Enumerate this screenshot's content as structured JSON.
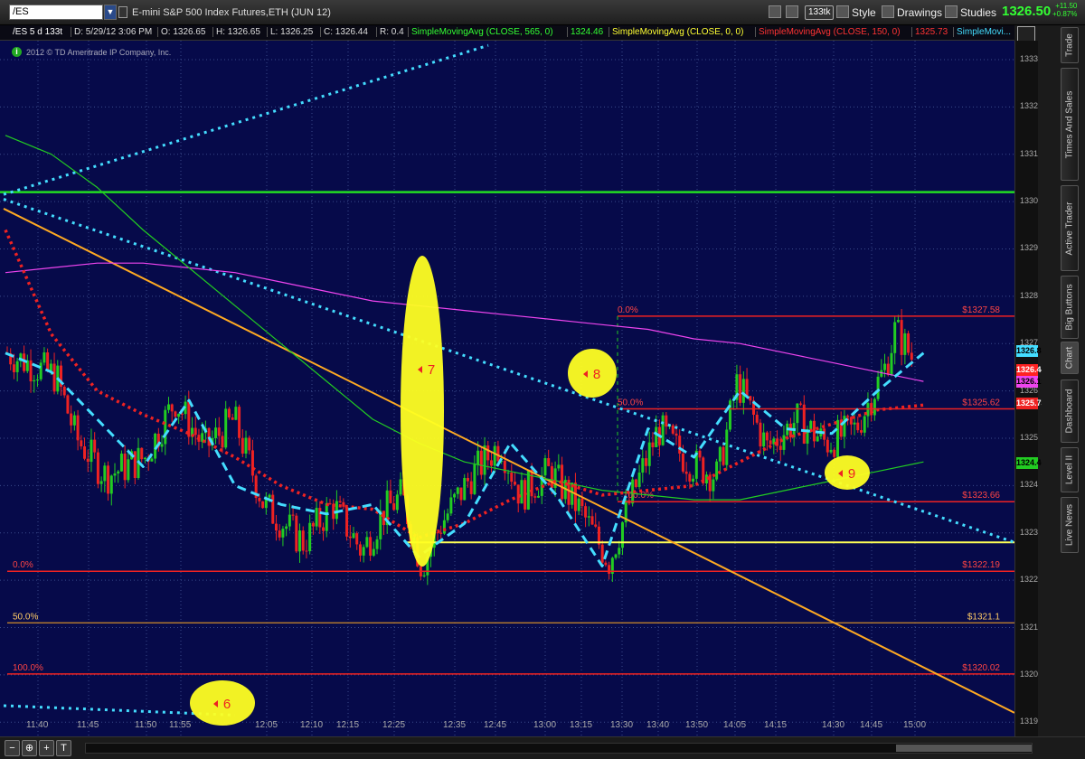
{
  "toolbar": {
    "symbol": "/ES",
    "instrument_title": "E-mini S&P 500 Index Futures,ETH (JUN 12)",
    "aggregation_badge": "133tk",
    "style_label": "Style",
    "drawings_label": "Drawings",
    "studies_label": "Studies",
    "last_price": "1326.50",
    "net_change": "+11.50",
    "pct_change": "+0.87%"
  },
  "infobar": {
    "period": "/ES 5 d 133t",
    "date": "D: 5/29/12 3:06 PM",
    "open": "O: 1326.65",
    "high": "H: 1326.65",
    "low": "L: 1326.25",
    "close": "C: 1326.44",
    "range": "R: 0.4",
    "study1": "SimpleMovingAvg (CLOSE, 565, 0)",
    "study1_value": "1324.46",
    "study2": "SimpleMovingAvg (CLOSE, 0, 0)",
    "study3": "SimpleMovingAvg (CLOSE, 150, 0)",
    "study3_value": "1325.73",
    "study4": "SimpleMovi..."
  },
  "copyright": "2012 © TD Ameritrade IP Company, Inc.",
  "price_axis": {
    "ticks": [
      "1333",
      "1332",
      "1331",
      "1330",
      "1329",
      "1328",
      "1327",
      "1326",
      "1325",
      "1324",
      "1323",
      "1322",
      "1321",
      "1320",
      "1319"
    ],
    "labels": [
      {
        "text": "1326.83",
        "price": 1326.83,
        "bg": "#44ddff",
        "fg": "#000"
      },
      {
        "text": "1326.44",
        "price": 1326.44,
        "bg": "#ff2222",
        "fg": "#fff"
      },
      {
        "text": "1326.19",
        "price": 1326.19,
        "bg": "#ee44ee",
        "fg": "#000"
      },
      {
        "text": "1325.73",
        "price": 1325.73,
        "bg": "#ee2222",
        "fg": "#fff"
      },
      {
        "text": "1324.46",
        "price": 1324.46,
        "bg": "#22cc22",
        "fg": "#000"
      }
    ]
  },
  "time_axis": {
    "ticks": [
      "11:40",
      "11:45",
      "11:50",
      "11:55",
      "12:05",
      "12:10",
      "12:15",
      "12:25",
      "12:35",
      "12:45",
      "13:00",
      "13:15",
      "13:30",
      "13:40",
      "13:50",
      "14:05",
      "14:15",
      "14:30",
      "14:45",
      "15:00"
    ]
  },
  "side_tabs": [
    "Trade",
    "Times And Sales",
    "Active Trader",
    "Big Buttons",
    "Chart",
    "Dashboard",
    "Level II",
    "Live News"
  ],
  "bottom_buttons": [
    "−",
    "⊕",
    "+",
    "T"
  ],
  "chart_data": {
    "type": "line",
    "y_range": [
      1318.7,
      1333.4
    ],
    "annotations": {
      "fib1": [
        {
          "text": "0.0%",
          "price": 1327.58,
          "value_label": "$1327.58"
        },
        {
          "text": "50.0%",
          "price": 1325.62,
          "value_label": "$1325.62"
        },
        {
          "text": "100.0%",
          "price": 1323.66,
          "value_label": "$1323.66"
        }
      ],
      "fib2": [
        {
          "text": "0.0%",
          "price": 1322.19,
          "value_label": "$1322.19"
        },
        {
          "text": "50.0%",
          "price": 1321.1,
          "value_label": "$1321.1"
        },
        {
          "text": "100.0%",
          "price": 1320.02,
          "value_label": "$1320.02"
        }
      ],
      "markers": [
        "6",
        "7",
        "8",
        "9"
      ],
      "green_level": 1330.2,
      "yellow_level": 1322.8
    },
    "colors": {
      "background": "#060a4a",
      "up": "#22cc22",
      "down": "#ee2222",
      "sma_cyan": "#44ddff",
      "sma_red": "#ee2222",
      "sma_magenta": "#ee44ee",
      "sma_green": "#22cc22",
      "trend": "#ffaa22",
      "highlight": "#ffff22"
    },
    "x_pct": [
      0,
      5,
      10,
      15,
      20,
      25,
      30,
      35,
      40,
      45,
      50,
      55,
      60,
      65,
      70,
      75,
      80,
      85,
      90,
      95,
      100
    ],
    "sma_magenta": [
      1328.5,
      1328.6,
      1328.7,
      1328.7,
      1328.6,
      1328.5,
      1328.3,
      1328.1,
      1327.9,
      1327.8,
      1327.7,
      1327.6,
      1327.5,
      1327.4,
      1327.3,
      1327.1,
      1327.0,
      1326.8,
      1326.6,
      1326.4,
      1326.2
    ],
    "sma_green": [
      1331.4,
      1331.0,
      1330.3,
      1329.4,
      1328.6,
      1327.8,
      1327.0,
      1326.2,
      1325.4,
      1324.9,
      1324.5,
      1324.3,
      1324.1,
      1323.9,
      1323.8,
      1323.7,
      1323.7,
      1323.9,
      1324.1,
      1324.3,
      1324.5
    ],
    "sma_red": [
      1329.4,
      1327.2,
      1326.0,
      1325.5,
      1325.1,
      1324.6,
      1324.0,
      1323.6,
      1323.5,
      1322.9,
      1323.2,
      1323.7,
      1324.1,
      1323.8,
      1323.9,
      1324.0,
      1324.5,
      1325.0,
      1325.3,
      1325.6,
      1325.7
    ],
    "sma_cyan": [
      1326.8,
      1326.4,
      1325.4,
      1324.4,
      1325.8,
      1324.0,
      1323.6,
      1323.4,
      1323.6,
      1322.5,
      1323.2,
      1324.9,
      1323.8,
      1322.3,
      1325.2,
      1324.6,
      1326.0,
      1325.2,
      1325.1,
      1326.0,
      1326.8
    ]
  }
}
